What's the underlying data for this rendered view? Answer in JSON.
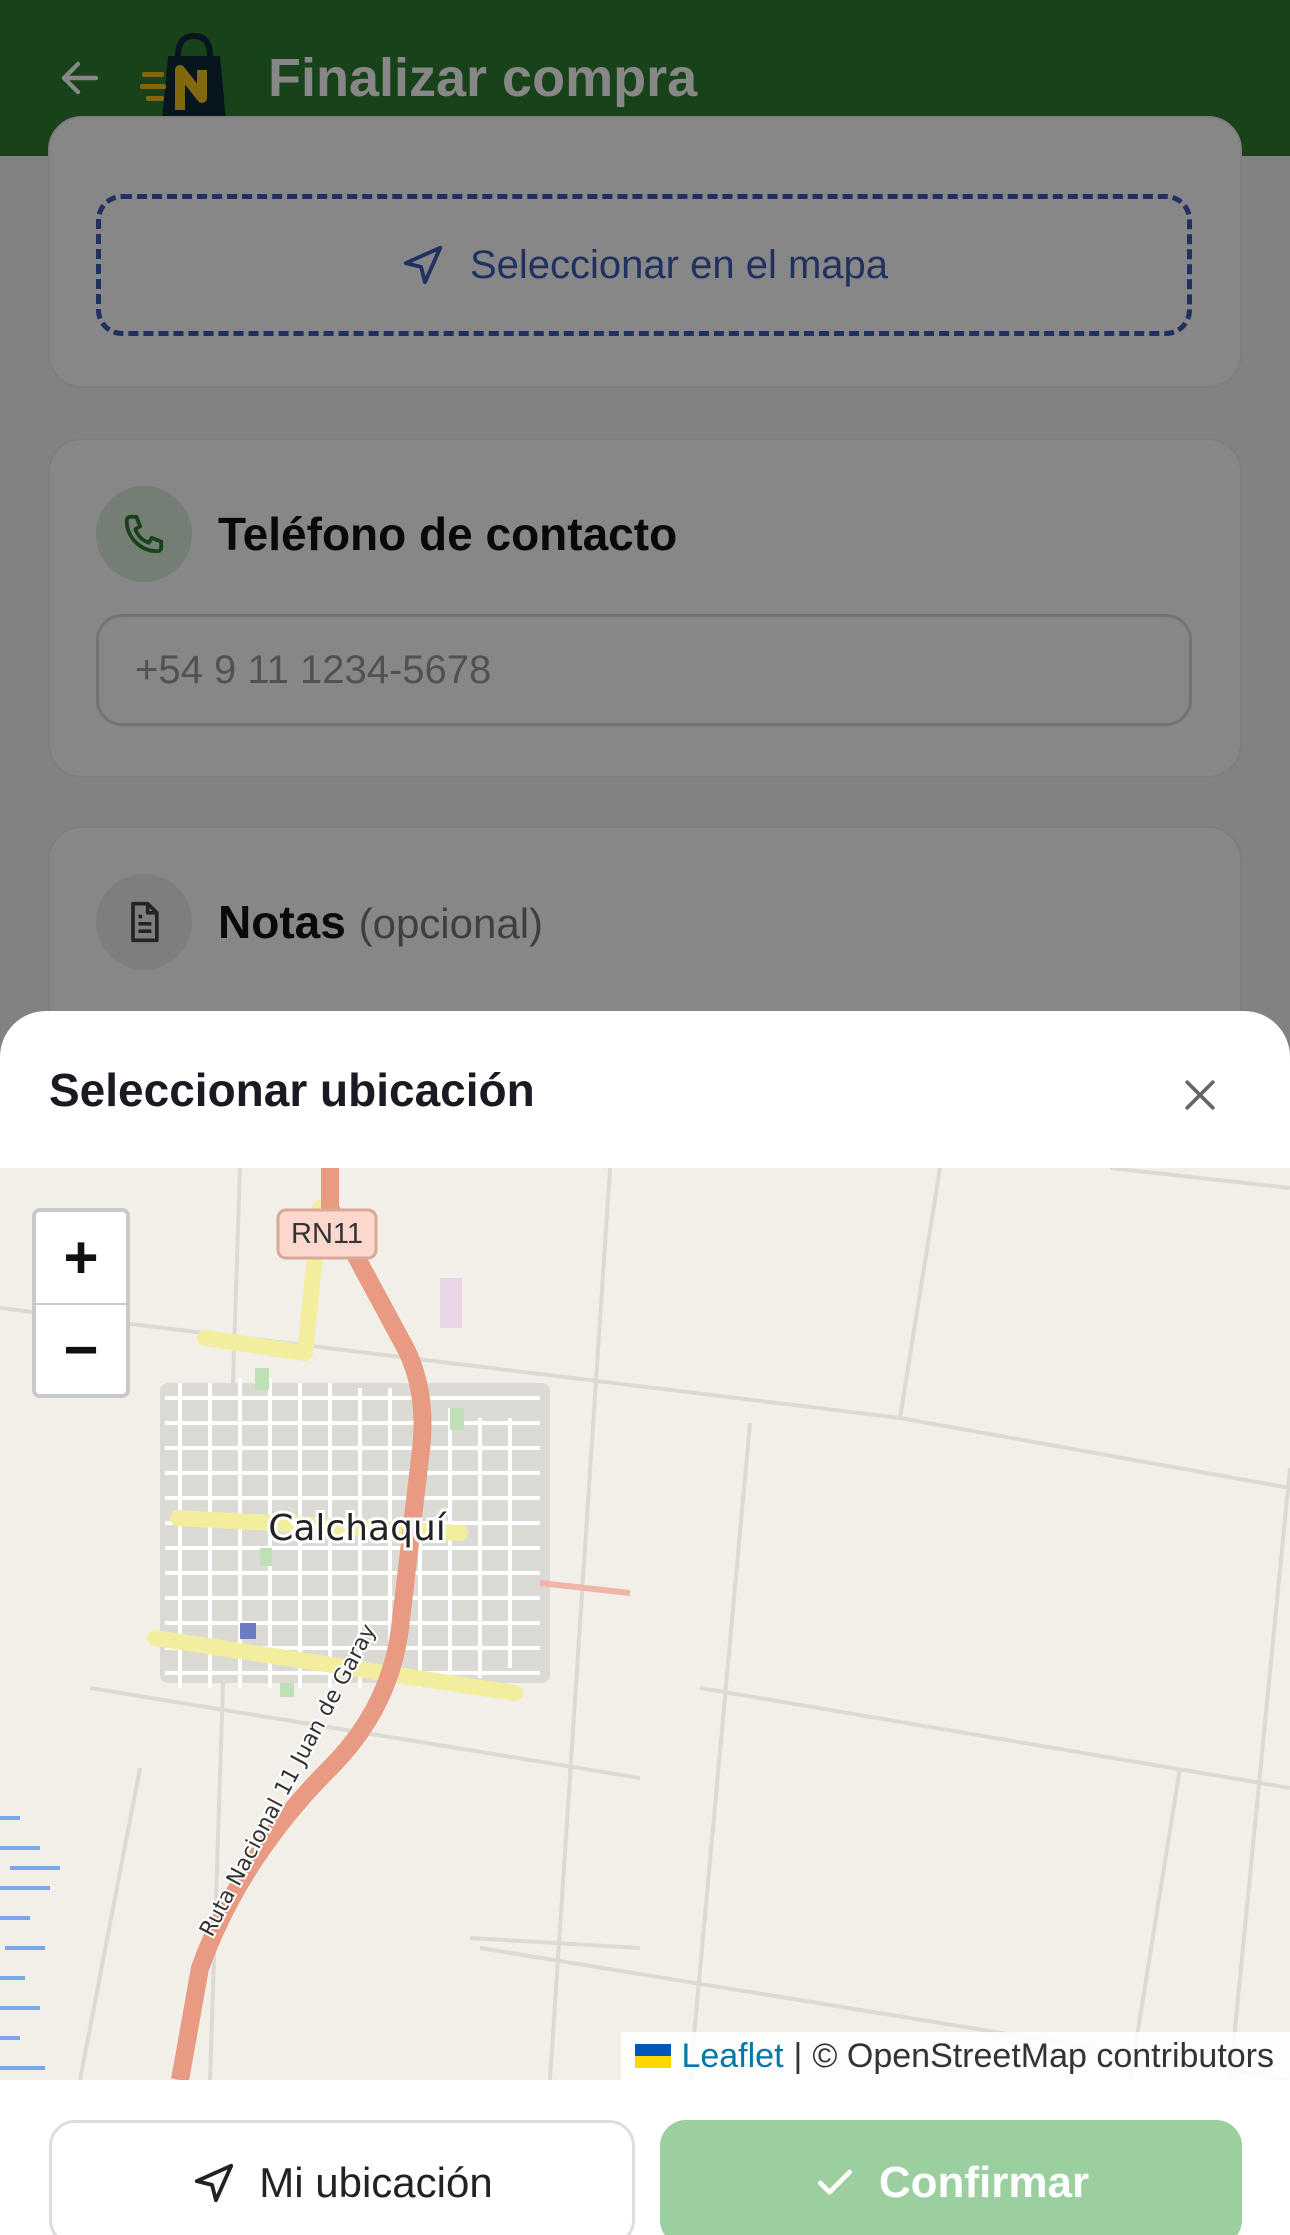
{
  "header": {
    "title": "Finalizar compra",
    "back_icon": "arrow-left-icon",
    "logo_icon": "shopping-bag-logo",
    "color": "#2e7d32"
  },
  "address_card": {
    "map_button_label": "Seleccionar en el mapa",
    "map_button_icon": "navigation-arrow-icon",
    "accent": "#3b5bb8"
  },
  "phone_card": {
    "title": "Teléfono de contacto",
    "icon": "phone-icon",
    "input_placeholder": "+54 9 11 1234-5678"
  },
  "notes_card": {
    "title": "Notas",
    "title_suffix": "(opcional)",
    "icon": "document-icon"
  },
  "sheet": {
    "title": "Seleccionar ubicación",
    "close_icon": "close-icon",
    "map": {
      "zoom_in": "+",
      "zoom_out": "−",
      "road_shield": "RN11",
      "town_label": "Calchaquí",
      "road_label": "Ruta Nacional 11 Juan de Garay",
      "attribution_leaflet": "Leaflet",
      "attribution_separator": "|",
      "attribution_osm": "© OpenStreetMap contributors"
    },
    "actions": {
      "my_location_label": "Mi ubicación",
      "my_location_icon": "navigation-arrow-icon",
      "confirm_label": "Confirmar",
      "confirm_icon": "check-icon",
      "confirm_color": "#9bcf9f"
    }
  }
}
